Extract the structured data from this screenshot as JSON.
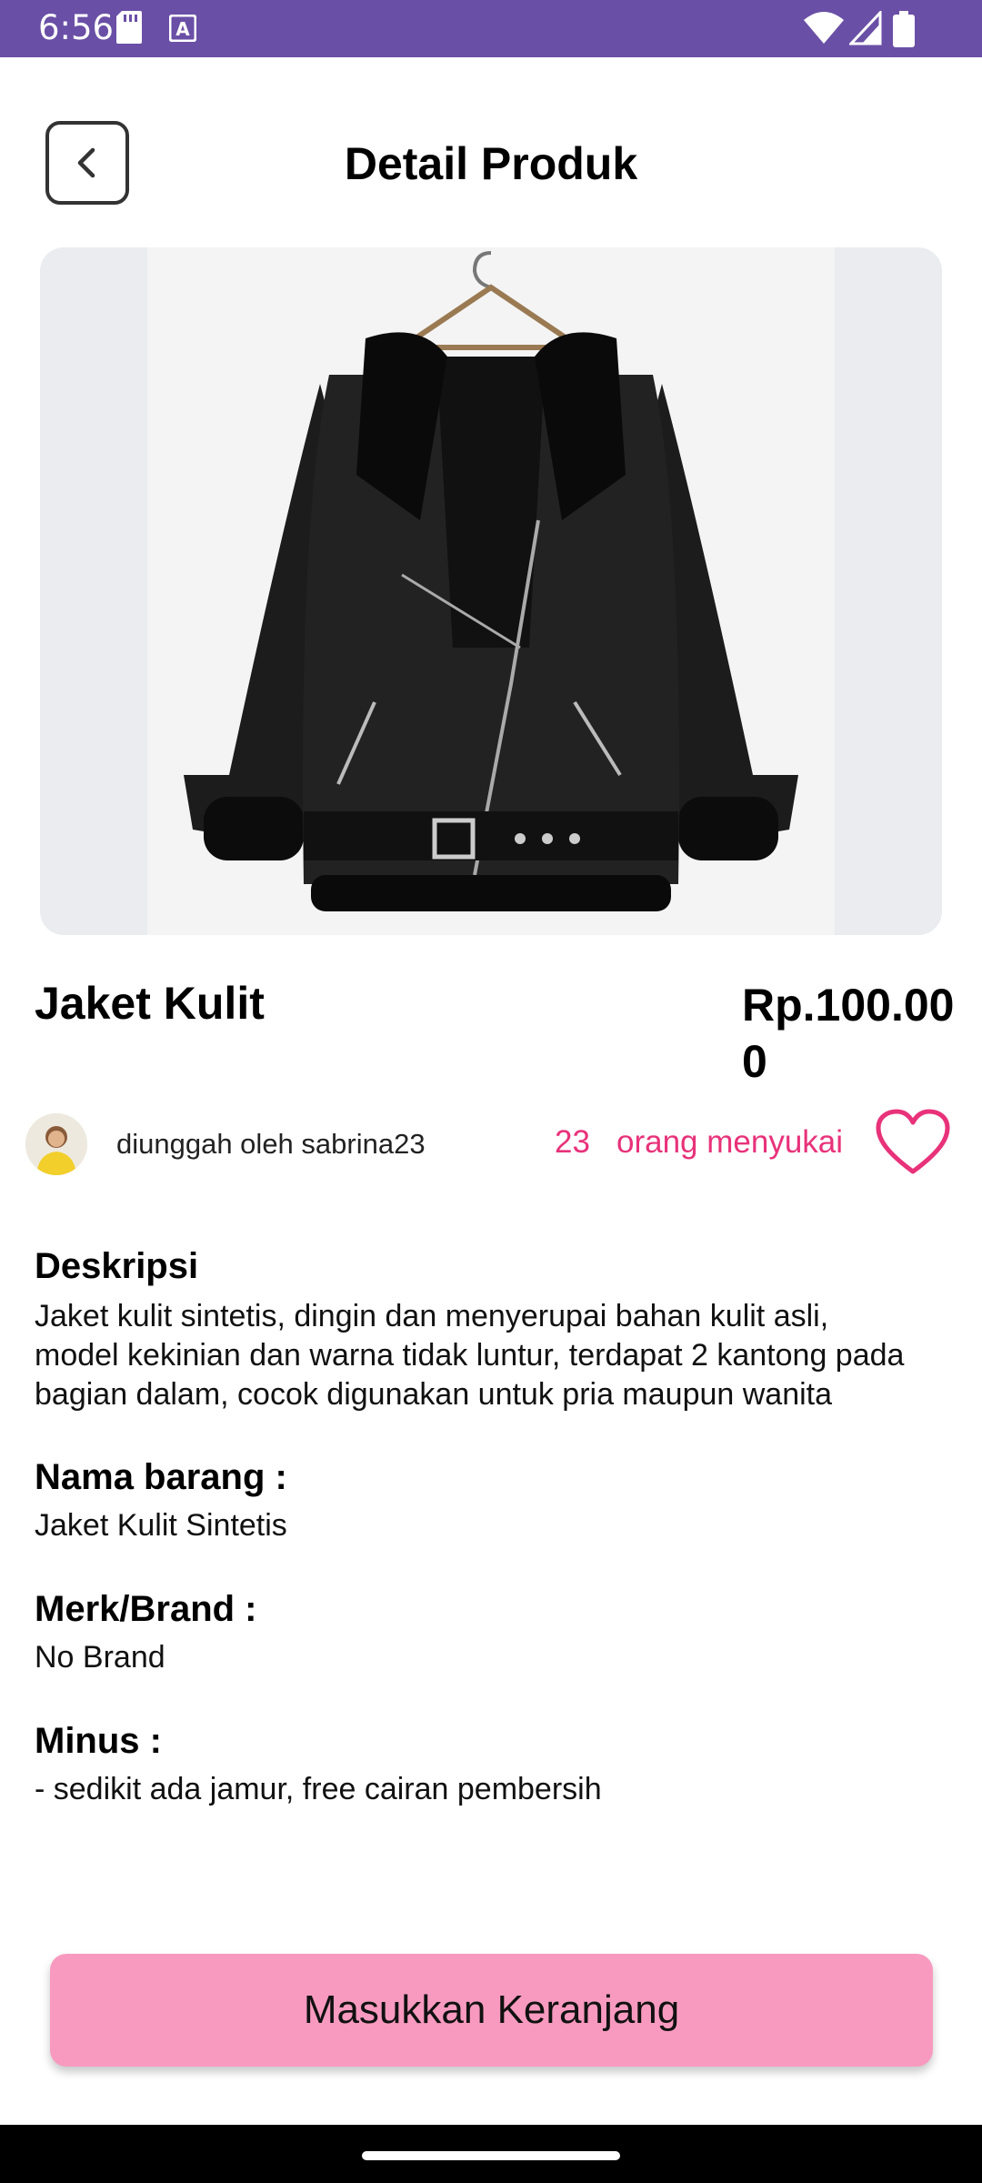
{
  "status_bar": {
    "time": "6:56",
    "icons": [
      "sd-card-icon",
      "a-notification-icon",
      "wifi-icon",
      "signal-icon",
      "battery-icon"
    ]
  },
  "header": {
    "title": "Detail Produk",
    "back_icon": "chevron-left-icon"
  },
  "product": {
    "image_alt": "black leather jacket",
    "name": "Jaket Kulit",
    "price": "Rp.100.000"
  },
  "uploader": {
    "label": "diunggah oleh sabrina23",
    "like_count": "23",
    "like_label": "orang menyukai",
    "heart_icon": "heart-outline-icon"
  },
  "details": {
    "description_title": "Deskripsi",
    "description_lines": [
      "Jaket kulit sintetis, dingin dan menyerupai bahan kulit asli,",
      "model kekinian dan warna tidak luntur, terdapat 2 kantong pada",
      "bagian dalam, cocok digunakan untuk pria maupun wanita"
    ],
    "item_name_title": "Nama barang :",
    "item_name": "Jaket Kulit Sintetis",
    "brand_title": "Merk/Brand :",
    "brand": "No Brand",
    "minus_title": "Minus :",
    "minus": "- sedikit ada jamur, free cairan pembersih"
  },
  "cart_button": {
    "label": "Masukkan Keranjang"
  },
  "colors": {
    "status_bar": "#6a4fa6",
    "accent_pink": "#e8327a",
    "button_pink": "#f89abf"
  }
}
